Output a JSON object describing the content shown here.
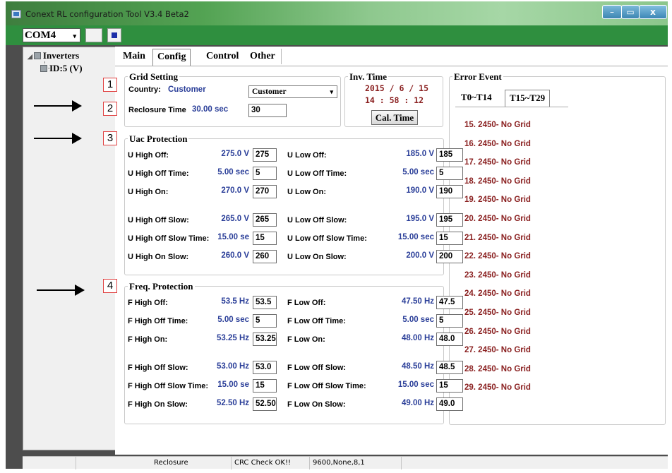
{
  "window": {
    "title": "Conext RL configuration Tool V3.4 Beta2",
    "minimize_glyph": "–",
    "maximize_glyph": "▭",
    "close_glyph": "x"
  },
  "toolbar": {
    "port": "COM4",
    "dropdown_glyph": "▾"
  },
  "tree": {
    "root_label": "Inverters",
    "child_label": "ID:5 (V)",
    "expand_glyph": "◢"
  },
  "tabs": {
    "main": "Main",
    "config": "Config",
    "control": "Control",
    "other": "Other"
  },
  "grid_setting": {
    "title": "Grid Setting",
    "country_label": "Country:",
    "country_value": "Customer",
    "country_selected": "Customer",
    "dropdown_glyph": "▾",
    "reclosure_label": "Reclosure Time",
    "reclosure_value": "30.00 sec",
    "reclosure_input": "30"
  },
  "inv_time": {
    "title": "Inv. Time",
    "date": "2015 / 6 / 15",
    "clock": "14 : 58 : 12",
    "cal_button": "Cal. Time"
  },
  "uac": {
    "title": "Uac Protection",
    "left": [
      {
        "label": "U High Off:",
        "value": "275.0 V",
        "input": "275"
      },
      {
        "label": "U High Off Time:",
        "value": "5.00 sec",
        "input": "5"
      },
      {
        "label": "U High On:",
        "value": "270.0 V",
        "input": "270"
      },
      {
        "label": "U High Off Slow:",
        "value": "265.0 V",
        "input": "265"
      },
      {
        "label": "U High Off Slow Time:",
        "value": "15.00 se",
        "input": "15"
      },
      {
        "label": "U High On Slow:",
        "value": "260.0 V",
        "input": "260"
      }
    ],
    "right": [
      {
        "label": "U Low Off:",
        "value": "185.0 V",
        "input": "185"
      },
      {
        "label": "U Low Off Time:",
        "value": "5.00 sec",
        "input": "5"
      },
      {
        "label": "U Low On:",
        "value": "190.0 V",
        "input": "190"
      },
      {
        "label": "U Low Off Slow:",
        "value": "195.0 V",
        "input": "195"
      },
      {
        "label": "U Low Off Slow Time:",
        "value": "15.00 sec",
        "input": "15"
      },
      {
        "label": "U Low On Slow:",
        "value": "200.0 V",
        "input": "200"
      }
    ]
  },
  "freq": {
    "title": "Freq. Protection",
    "left": [
      {
        "label": "F High Off:",
        "value": "53.5 Hz",
        "input": "53.5"
      },
      {
        "label": "F High Off Time:",
        "value": "5.00 sec",
        "input": "5"
      },
      {
        "label": "F High On:",
        "value": "53.25 Hz",
        "input": "53.25"
      },
      {
        "label": "F High Off Slow:",
        "value": "53.00 Hz",
        "input": "53.0"
      },
      {
        "label": "F High Off Slow Time:",
        "value": "15.00 se",
        "input": "15"
      },
      {
        "label": "F High On Slow:",
        "value": "52.50 Hz",
        "input": "52.50"
      }
    ],
    "right": [
      {
        "label": "F Low Off:",
        "value": "47.50 Hz",
        "input": "47.5"
      },
      {
        "label": "F Low Off Time:",
        "value": "5.00 sec",
        "input": "5"
      },
      {
        "label": "F Low On:",
        "value": "48.00 Hz",
        "input": "48.0"
      },
      {
        "label": "F Low Off Slow:",
        "value": "48.50 Hz",
        "input": "48.5"
      },
      {
        "label": "F Low Off Slow Time:",
        "value": "15.00 sec",
        "input": "15"
      },
      {
        "label": "F Low On Slow:",
        "value": "49.00 Hz",
        "input": "49.0"
      }
    ]
  },
  "error_event": {
    "title": "Error Event",
    "tab1": "T0~T14",
    "tab2": "T15~T29",
    "items": [
      "15. 2450- No Grid",
      "16. 2450- No Grid",
      "17. 2450- No Grid",
      "18. 2450- No Grid",
      "19. 2450- No Grid",
      "20. 2450- No Grid",
      "21. 2450- No Grid",
      "22. 2450- No Grid",
      "23. 2450- No Grid",
      "24. 2450- No Grid",
      "25. 2450- No Grid",
      "26. 2450- No Grid",
      "27. 2450- No Grid",
      "28. 2450- No Grid",
      "29. 2450- No Grid"
    ]
  },
  "callouts": [
    "1",
    "2",
    "3",
    "4"
  ],
  "status": {
    "s1": "",
    "s2": "Reclosure",
    "s3": "CRC Check OK!!",
    "s4": "9600,None,8,1"
  },
  "colors": {
    "value_blue": "#2b3f99",
    "event_red": "#8a2020",
    "toolbar_green": "#2f8f3f"
  }
}
